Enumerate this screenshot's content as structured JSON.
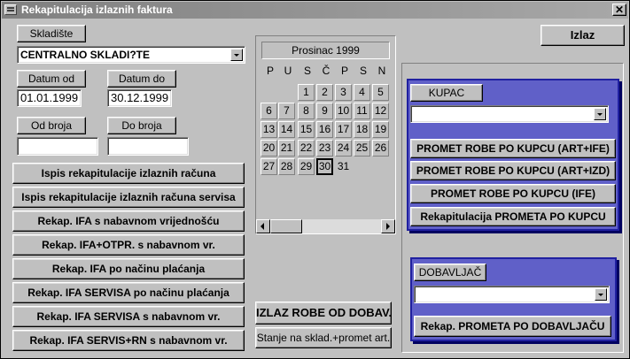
{
  "window": {
    "title": "Rekapitulacija izlaznih faktura",
    "close_label": "✕"
  },
  "left": {
    "skladiste_label": "Skladište",
    "skladiste_value": "CENTRALNO SKLADI?TE",
    "datum_od_label": "Datum od",
    "datum_do_label": "Datum do",
    "datum_od_value": "01.01.1999",
    "datum_do_value": "30.12.1999",
    "od_broja_label": "Od broja",
    "do_broja_label": "Do broja",
    "od_broja_value": "",
    "do_broja_value": "",
    "buttons": [
      "Ispis rekapitulacije izlaznih računa",
      "Ispis rekapitulacije izlaznih računa servisa",
      "Rekap. IFA s nabavnom vrijednošću",
      "Rekap. IFA+OTPR. s nabavnom vr.",
      "Rekap. IFA po načinu plaćanja",
      "Rekap. IFA SERVISA po načinu plaćanja",
      "Rekap. IFA SERVISA s nabavnom vr.",
      "Rekap. IFA SERVIS+RN s nabavnom vr."
    ]
  },
  "calendar": {
    "month_label": "Prosinac 1999",
    "weekdays": [
      "P",
      "U",
      "S",
      "Č",
      "P",
      "S",
      "N"
    ],
    "days": [
      "1",
      "2",
      "3",
      "4",
      "5",
      "6",
      "7",
      "8",
      "9",
      "10",
      "11",
      "12",
      "13",
      "14",
      "15",
      "16",
      "17",
      "18",
      "19",
      "20",
      "21",
      "22",
      "23",
      "24",
      "25",
      "26",
      "27",
      "28",
      "29",
      "30",
      "31"
    ],
    "selected_day": "30"
  },
  "middle": {
    "izlaz_robe_label": "IZLAZ ROBE OD DOBAV.",
    "stanje_label": "Stanje na sklad.+promet art."
  },
  "top_right": {
    "izlaz_label": "Izlaz"
  },
  "kupac_panel": {
    "kupac_label": "KUPAC",
    "kupac_value": "",
    "buttons": [
      "PROMET ROBE PO KUPCU (ART+IFE)",
      "PROMET ROBE PO KUPCU (ART+IZD)",
      "PROMET ROBE PO KUPCU (IFE)",
      "Rekapitulacija PROMETA PO KUPCU"
    ]
  },
  "dobavljac_panel": {
    "dobavljac_label": "DOBAVLJAČ",
    "dobavljac_value": "",
    "button": "Rekap. PROMETA PO DOBAVLJAČU"
  },
  "colors": {
    "panel_bg": "#6060c8",
    "window_bg": "#c0c0c0",
    "titlebar": "#808080"
  }
}
